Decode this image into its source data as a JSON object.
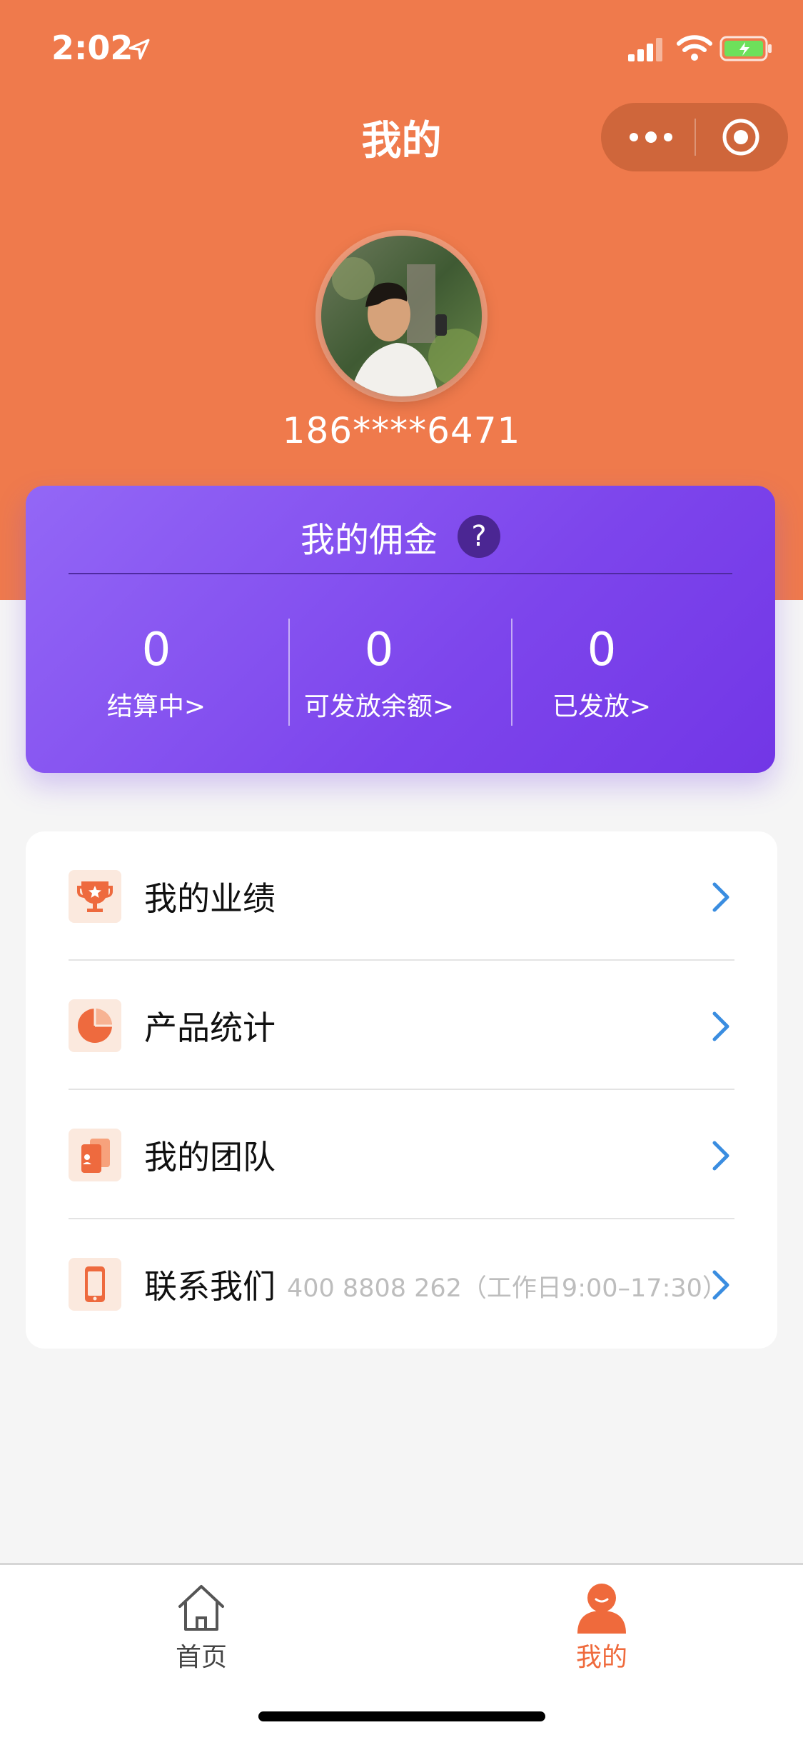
{
  "status_bar": {
    "time": "2:02"
  },
  "nav": {
    "title": "我的"
  },
  "profile": {
    "phone": "186****6471"
  },
  "commission": {
    "title": "我的佣金",
    "help": "?",
    "stats": [
      {
        "value": "0",
        "label": "结算中>"
      },
      {
        "value": "0",
        "label": "可发放余额>"
      },
      {
        "value": "0",
        "label": "已发放>"
      }
    ]
  },
  "menu": {
    "items": [
      {
        "label": "我的业绩",
        "icon": "trophy-icon"
      },
      {
        "label": "产品统计",
        "icon": "pie-chart-icon"
      },
      {
        "label": "我的团队",
        "icon": "team-icon"
      },
      {
        "label": "联系我们",
        "sub": "400 8808 262（工作日9:00–17:30）",
        "icon": "phone-icon"
      }
    ]
  },
  "tabbar": {
    "items": [
      {
        "label": "首页",
        "icon": "home-icon"
      },
      {
        "label": "我的",
        "icon": "user-icon",
        "active": true
      }
    ]
  },
  "colors": {
    "accent": "#ef7a4c",
    "card": "#7d45ec",
    "chevron": "#3a8de0",
    "active_tab": "#ef6a3c"
  }
}
